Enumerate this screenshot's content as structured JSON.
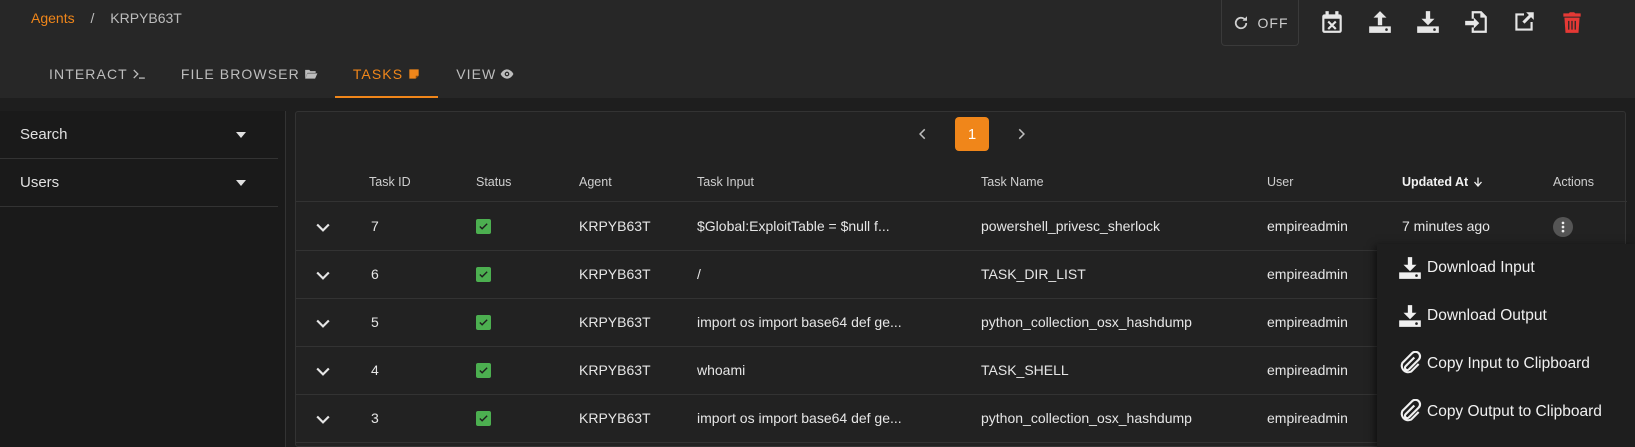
{
  "breadcrumb": {
    "root": "Agents",
    "separator": "/",
    "current": "KRPYB63T"
  },
  "tabs": [
    {
      "label": "INTERACT",
      "icon": "console-icon"
    },
    {
      "label": "FILE BROWSER",
      "icon": "folder-open-icon"
    },
    {
      "label": "TASKS",
      "icon": "note-icon",
      "active": true
    },
    {
      "label": "VIEW",
      "icon": "eye-icon"
    }
  ],
  "refresh": {
    "label": "OFF",
    "icon": "refresh-icon"
  },
  "toolbar": {
    "icons": [
      "calendar-remove-icon",
      "upload-icon",
      "download-icon",
      "import-icon",
      "open-in-new-icon",
      "delete-icon"
    ],
    "delete_color": "#e53935"
  },
  "filters": [
    {
      "label": "Search"
    },
    {
      "label": "Users"
    }
  ],
  "pagination": {
    "current_page": "1"
  },
  "table": {
    "headers": {
      "task_id": "Task ID",
      "status": "Status",
      "agent": "Agent",
      "task_input": "Task Input",
      "task_name": "Task Name",
      "user": "User",
      "updated_at": "Updated At",
      "actions": "Actions"
    },
    "rows": [
      {
        "task_id": "7",
        "agent": "KRPYB63T",
        "task_input": "$Global:ExploitTable = $null f...",
        "task_name": "powershell_privesc_sherlock",
        "user": "empireadmin",
        "updated_at": "7 minutes ago"
      },
      {
        "task_id": "6",
        "agent": "KRPYB63T",
        "task_input": "/",
        "task_name": "TASK_DIR_LIST",
        "user": "empireadmin",
        "updated_at": ""
      },
      {
        "task_id": "5",
        "agent": "KRPYB63T",
        "task_input": "import os import base64 def ge...",
        "task_name": "python_collection_osx_hashdump",
        "user": "empireadmin",
        "updated_at": ""
      },
      {
        "task_id": "4",
        "agent": "KRPYB63T",
        "task_input": "whoami",
        "task_name": "TASK_SHELL",
        "user": "empireadmin",
        "updated_at": ""
      },
      {
        "task_id": "3",
        "agent": "KRPYB63T",
        "task_input": "import os import base64 def ge...",
        "task_name": "python_collection_osx_hashdump",
        "user": "empireadmin",
        "updated_at": ""
      }
    ]
  },
  "context_menu": [
    {
      "label": "Download Input",
      "icon": "download-icon"
    },
    {
      "label": "Download Output",
      "icon": "download-icon"
    },
    {
      "label": "Copy Input to Clipboard",
      "icon": "paperclip-icon"
    },
    {
      "label": "Copy Output to Clipboard",
      "icon": "paperclip-icon"
    }
  ],
  "colors": {
    "accent": "#f0861a",
    "success": "#4caf50",
    "background": "#1e1e1e"
  }
}
